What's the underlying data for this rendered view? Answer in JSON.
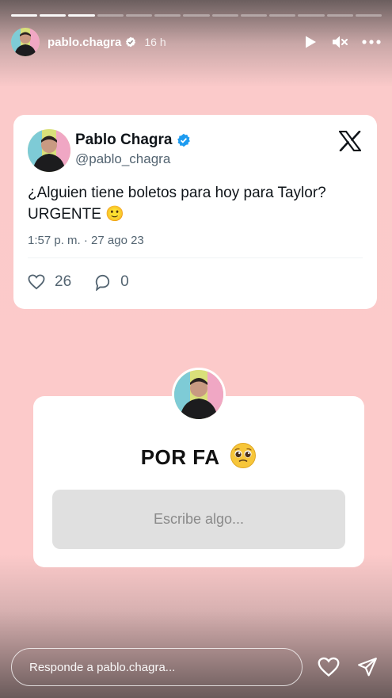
{
  "progress": {
    "total_segments": 13,
    "completed_segments": 3
  },
  "header": {
    "username": "pablo.chagra",
    "time": "16 h",
    "icons": [
      "play-icon",
      "mute-icon",
      "more-icon"
    ]
  },
  "tweet": {
    "name": "Pablo Chagra",
    "handle": "@pablo_chagra",
    "text_line1": "¿Alguien tiene boletos para hoy para Taylor?",
    "text_line2": "URGENTE",
    "text_emoji": "🙂",
    "date": "1:57 p. m. · 27 ago 23",
    "likes": "26",
    "replies": "0",
    "verified_color": "#1d9bf0"
  },
  "question": {
    "title": "POR FA",
    "input_placeholder": "Escribe algo..."
  },
  "footer": {
    "reply_placeholder": "Responde a pablo.chagra..."
  }
}
